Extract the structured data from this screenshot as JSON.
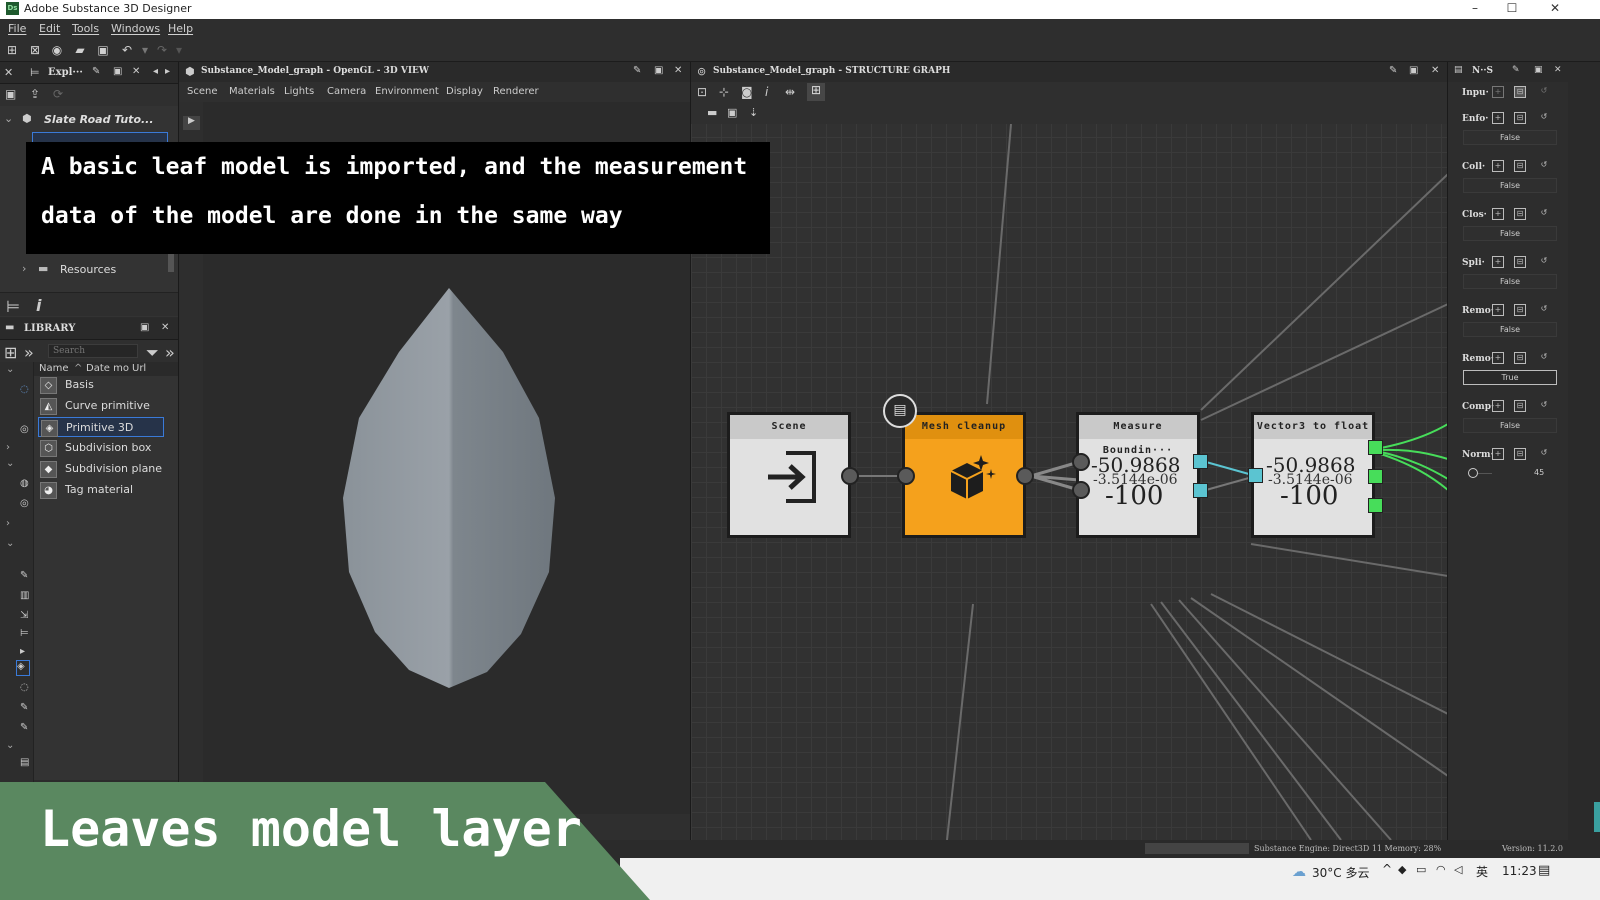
{
  "window": {
    "app_icon": "Ds",
    "title": "Adobe Substance 3D Designer",
    "min_glyph": "–",
    "max_glyph": "☐",
    "close_glyph": "✕"
  },
  "menu": [
    "File",
    "Edit",
    "Tools",
    "Windows",
    "Help"
  ],
  "explorer": {
    "tab_label": "Expl···",
    "package_name": "Slate Road Tuto...",
    "resources_label": "Resources"
  },
  "library": {
    "title": "LIBRARY",
    "search_placeholder": "Search",
    "columns": [
      "Name",
      "Date mo",
      "Url"
    ],
    "items": [
      "Basis",
      "Curve primitive",
      "Primitive 3D",
      "Subdivision box",
      "Subdivision plane",
      "Tag material"
    ]
  },
  "view3d": {
    "title": "Substance_Model_graph - OpenGL - 3D VIEW",
    "tabs": [
      "Scene",
      "Materials",
      "Lights",
      "Camera",
      "Environment",
      "Display",
      "Renderer"
    ]
  },
  "graph": {
    "title": "Substance_Model_graph - STRUCTURE GRAPH",
    "nodes": {
      "scene": {
        "title": "Scene"
      },
      "mesh_cleanup": {
        "title": "Mesh cleanup"
      },
      "measure": {
        "title": "Measure Boundin···",
        "v1": "-50.9868",
        "v2": "-3.5144e-06",
        "v3": "-100"
      },
      "vector3": {
        "title": "Vector3 to float",
        "v1": "-50.9868",
        "v2": "-3.5144e-06",
        "v3": "-100"
      }
    }
  },
  "params": {
    "title": "N··S",
    "rows": [
      {
        "label": "Inpu·",
        "value": ""
      },
      {
        "label": "Enfo·",
        "value": "False"
      },
      {
        "label": "Coll·",
        "value": "False"
      },
      {
        "label": "Clos·",
        "value": "False"
      },
      {
        "label": "Spli·",
        "value": "False"
      },
      {
        "label": "Remo·",
        "value": "False"
      },
      {
        "label": "Remo·",
        "value": "True"
      },
      {
        "label": "Comp·",
        "value": "False"
      },
      {
        "label": "Norm·",
        "value": "45"
      }
    ]
  },
  "status": {
    "engine": "Substance Engine: Direct3D 11 Memory: 28%",
    "version": "Version: 11.2.0"
  },
  "taskbar": {
    "weather": "30°C 多云",
    "ime": "英",
    "time": "11:23"
  },
  "caption": {
    "line1": "A basic leaf model is imported, and the measurement",
    "line2": "data of the model are done in the same way"
  },
  "banner": {
    "text": "Leaves model layer",
    "color": "#5a8860"
  },
  "colors": {
    "mesh_node": "#f5a11c",
    "port_cyan": "#5bc4d1",
    "port_green": "#47dd5a"
  }
}
